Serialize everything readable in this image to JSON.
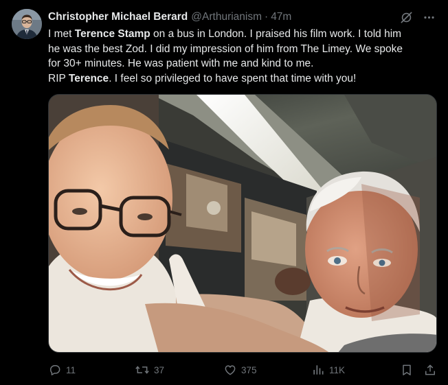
{
  "author": {
    "display_name": "Christopher Michael Berard",
    "handle": "@Arthurianism",
    "separator": "·",
    "time": "47m",
    "avatar_icon": "user-avatar"
  },
  "post": {
    "lines": [
      [
        {
          "text": "I met ",
          "bold": false
        },
        {
          "text": "Terence Stamp",
          "bold": true
        },
        {
          "text": " on a bus in London. I praised his film work. I told him",
          "bold": false
        }
      ],
      [
        {
          "text": "he was the best Zod. I did my impression of him from The Limey. We spoke",
          "bold": false
        }
      ],
      [
        {
          "text": "for 30+ minutes. He was patient with me and kind to me.",
          "bold": false
        }
      ],
      [
        {
          "text": "RIP ",
          "bold": false
        },
        {
          "text": "Terence",
          "bold": true
        },
        {
          "text": ". I feel so privileged to have spent that time with you!",
          "bold": false
        }
      ]
    ]
  },
  "media": {
    "kind": "selfie-photo"
  },
  "actions": {
    "replies": "11",
    "reposts": "37",
    "likes": "375",
    "views": "11K"
  },
  "header_icons": {
    "grok": "grok-icon",
    "more": "more-icon"
  },
  "colors": {
    "background": "#000000",
    "text": "#e7e9ea",
    "muted": "#71767b",
    "border": "#2f3336"
  }
}
